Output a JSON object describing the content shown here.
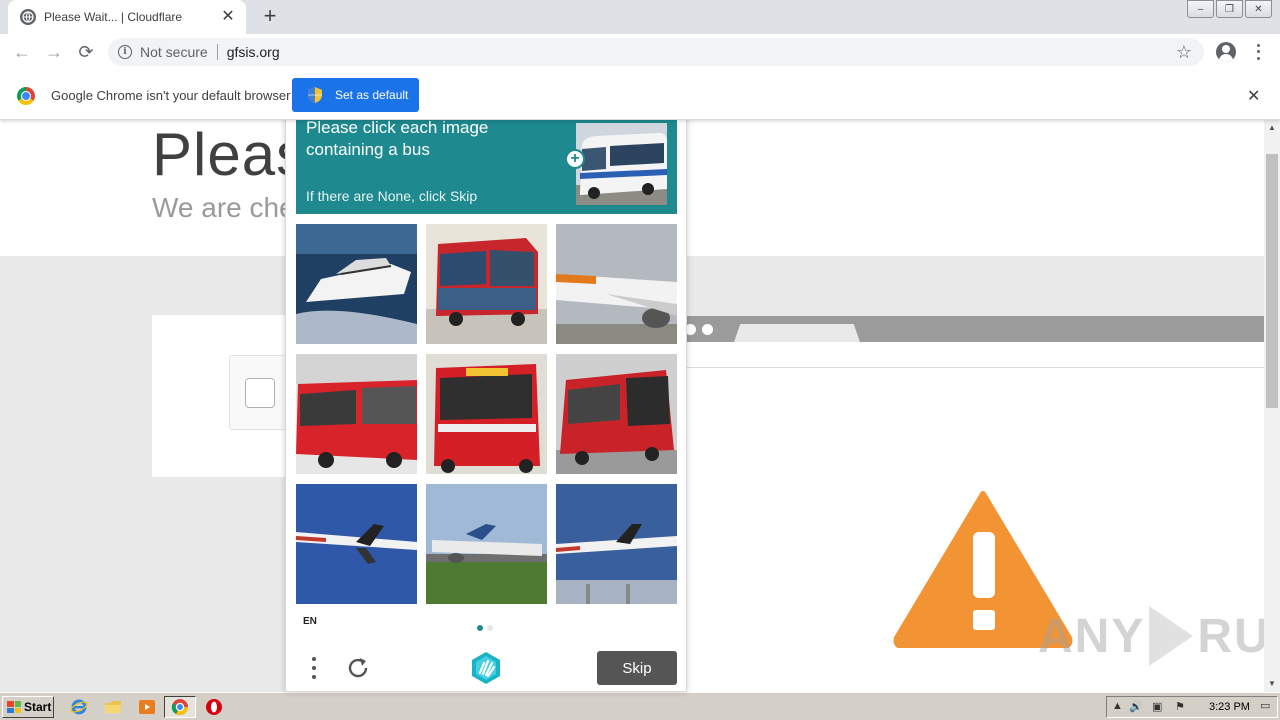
{
  "browser": {
    "tab_title": "Please Wait... | Cloudflare",
    "tab_close": "✕",
    "new_tab": "+",
    "security_label": "Not secure",
    "url": "gfsis.org",
    "window_buttons": [
      "–",
      "❐",
      "✕"
    ]
  },
  "infobar": {
    "message": "Google Chrome isn't your default browser",
    "set_default_label": "Set as default",
    "close": "✕"
  },
  "page": {
    "title": "Pleas",
    "subtitle": "We are che"
  },
  "captcha": {
    "prompt_line1": "Please click each image",
    "prompt_line2": "containing a bus",
    "prompt_sub": "If there are None, click Skip",
    "language": "EN",
    "skip_label": "Skip",
    "page_count": 2,
    "current_page": 1
  },
  "watermark": {
    "left": "ANY",
    "right": "RUN"
  },
  "taskbar": {
    "start_label": "Start",
    "clock": "3:23 PM"
  },
  "colors": {
    "captcha_teal": "#1e8a8f",
    "chrome_blue": "#1a73e8",
    "warning_orange": "#f29433"
  }
}
